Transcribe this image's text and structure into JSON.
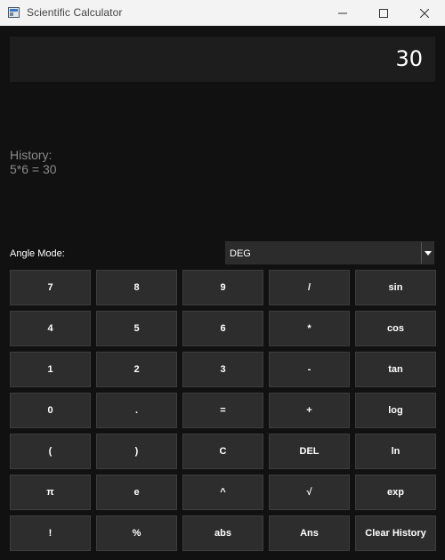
{
  "window": {
    "title": "Scientific Calculator",
    "controls": [
      "minimize",
      "maximize",
      "close"
    ]
  },
  "display": {
    "value": "30"
  },
  "history": {
    "label": "History:",
    "entries": [
      "5*6 = 30"
    ]
  },
  "angle_mode": {
    "label": "Angle Mode:",
    "selected": "DEG"
  },
  "keypad": {
    "keys": [
      "7",
      "8",
      "9",
      "/",
      "sin",
      "4",
      "5",
      "6",
      "*",
      "cos",
      "1",
      "2",
      "3",
      "-",
      "tan",
      "0",
      ".",
      "=",
      "+",
      "log",
      "(",
      ")",
      "C",
      "DEL",
      "ln",
      "π",
      "e",
      "^",
      "√",
      "exp",
      "!",
      "%",
      "abs",
      "Ans",
      "Clear History"
    ]
  },
  "colors": {
    "background": "#111111",
    "display_bg": "#1d1d1d",
    "button_bg": "#2d2d2d",
    "button_border": "#3d3d3d",
    "titlebar_bg": "#f3f3f3",
    "history_text": "#8a8a8a"
  }
}
